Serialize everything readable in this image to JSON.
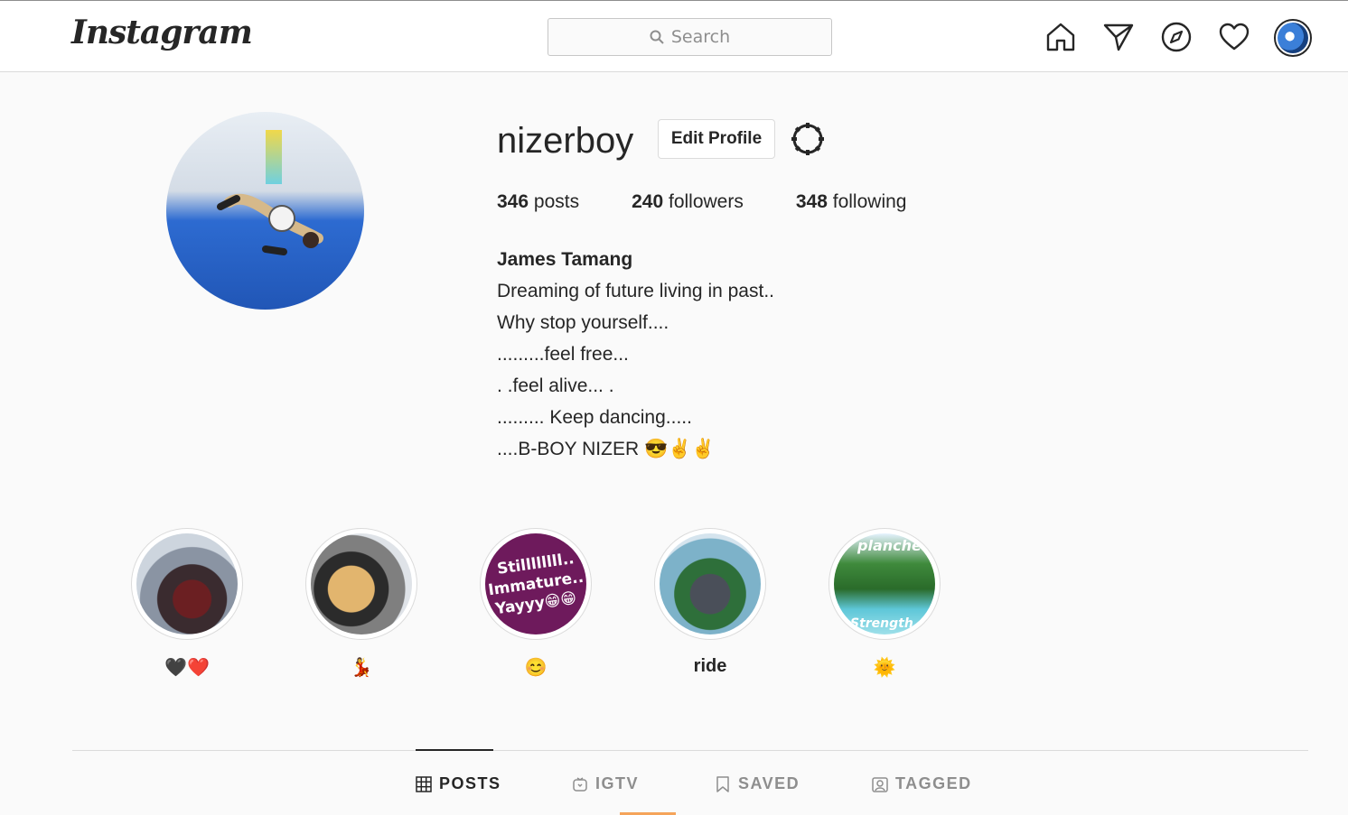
{
  "header": {
    "logo_text": "Instagram",
    "search_placeholder": "Search",
    "nav_icons": [
      "home-icon",
      "direct-message-icon",
      "explore-icon",
      "activity-heart-icon",
      "profile-avatar"
    ]
  },
  "profile": {
    "username": "nizerboy",
    "edit_profile_label": "Edit Profile",
    "stats": {
      "posts_count": "346",
      "posts_label": "posts",
      "followers_count": "240",
      "followers_label": "followers",
      "following_count": "348",
      "following_label": "following"
    },
    "full_name": "James Tamang",
    "bio_lines": [
      "Dreaming of future living in past..",
      "Why stop yourself....",
      ".........feel free...",
      ". .feel alive... .",
      "......... Keep dancing.....",
      "....B-BOY NIZER 😎✌✌"
    ]
  },
  "highlights": [
    {
      "label": "🖤❤️"
    },
    {
      "label": "💃"
    },
    {
      "label": "😊",
      "cover_text": [
        "Stillllllll..",
        "Immature..",
        "Yayyy😁😁"
      ]
    },
    {
      "label": "ride"
    },
    {
      "label": "🌞",
      "cover_text": [
        "planche",
        "Strength"
      ]
    }
  ],
  "tabs": [
    {
      "label": "POSTS",
      "icon": "grid-icon",
      "active": true
    },
    {
      "label": "IGTV",
      "icon": "igtv-icon",
      "active": false
    },
    {
      "label": "SAVED",
      "icon": "bookmark-icon",
      "active": false
    },
    {
      "label": "TAGGED",
      "icon": "tagged-icon",
      "active": false
    }
  ],
  "colors": {
    "text": "#262626",
    "muted": "#8e8e8e",
    "border": "#dbdbdb",
    "background": "#fafafa"
  }
}
